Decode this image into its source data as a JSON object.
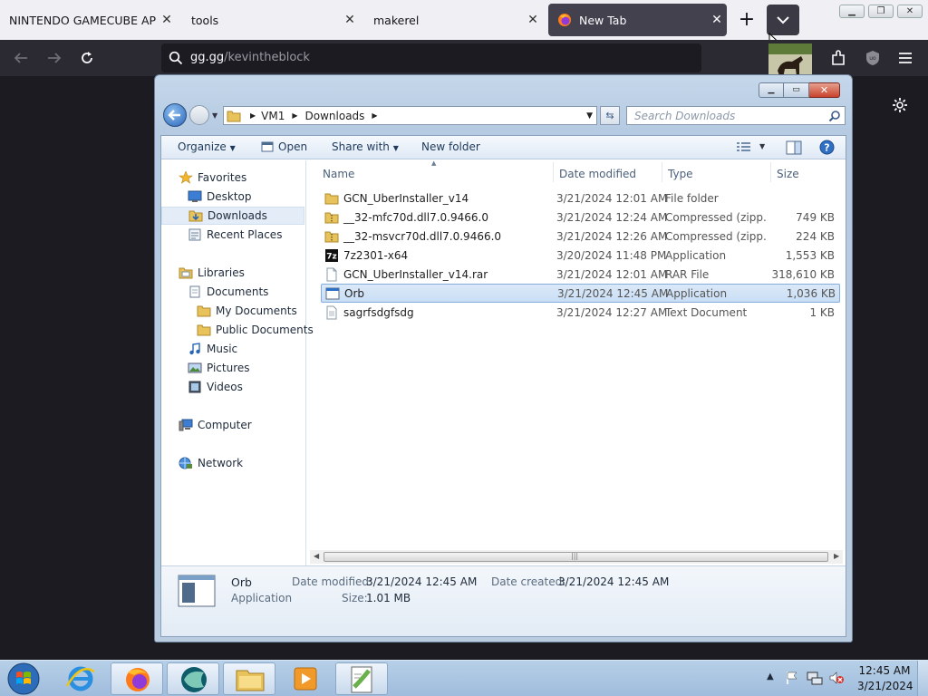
{
  "browser": {
    "tabs": [
      {
        "label": "NINTENDO GAMECUBE API Ref"
      },
      {
        "label": "tools"
      },
      {
        "label": "makerel"
      },
      {
        "label": "New Tab",
        "active": true
      }
    ],
    "close_glyph": "✕",
    "new_tab_glyph": "+",
    "url_host": "gg.gg",
    "url_path": "/kevintheblock",
    "url_placeholder_icon": "search-icon",
    "nav_icons": [
      "back-icon",
      "forward-icon",
      "reload-icon"
    ],
    "toolbar_icons": [
      "extensions-icon",
      "ublock-icon",
      "menu-icon"
    ],
    "colors": {
      "tabstrip": "#f0f0f4",
      "toolbar": "#2b2a33",
      "urlbar": "#1c1b22"
    }
  },
  "explorer": {
    "address": {
      "segments": [
        "VM1",
        "Downloads"
      ]
    },
    "search_placeholder": "Search Downloads",
    "commands": {
      "organize": "Organize",
      "open": "Open",
      "share_with": "Share with",
      "new_folder": "New folder"
    },
    "nav": {
      "favorites": "Favorites",
      "desktop": "Desktop",
      "downloads": "Downloads",
      "recent_places": "Recent Places",
      "libraries": "Libraries",
      "documents": "Documents",
      "my_documents": "My Documents",
      "public_documents": "Public Documents",
      "music": "Music",
      "pictures": "Pictures",
      "videos": "Videos",
      "computer": "Computer",
      "network": "Network"
    },
    "columns": {
      "name": "Name",
      "date": "Date modified",
      "type": "Type",
      "size": "Size"
    },
    "files": [
      {
        "name": "GCN_UberInstaller_v14",
        "date": "3/21/2024 12:01 AM",
        "type": "File folder",
        "size": "",
        "icon": "folder-icon"
      },
      {
        "name": "__32-mfc70d.dll7.0.9466.0",
        "date": "3/21/2024 12:24 AM",
        "type": "Compressed (zipp...",
        "size": "749 KB",
        "icon": "zip-folder-icon"
      },
      {
        "name": "__32-msvcr70d.dll7.0.9466.0",
        "date": "3/21/2024 12:26 AM",
        "type": "Compressed (zipp...",
        "size": "224 KB",
        "icon": "zip-folder-icon"
      },
      {
        "name": "7z2301-x64",
        "date": "3/20/2024 11:48 PM",
        "type": "Application",
        "size": "1,553 KB",
        "icon": "7zip-icon"
      },
      {
        "name": "GCN_UberInstaller_v14.rar",
        "date": "3/21/2024 12:01 AM",
        "type": "RAR File",
        "size": "318,610 KB",
        "icon": "file-icon"
      },
      {
        "name": "Orb",
        "date": "3/21/2024 12:45 AM",
        "type": "Application",
        "size": "1,036 KB",
        "icon": "application-icon",
        "selected": true
      },
      {
        "name": "sagrfsdgfsdg",
        "date": "3/21/2024 12:27 AM",
        "type": "Text Document",
        "size": "1 KB",
        "icon": "text-file-icon"
      }
    ],
    "details": {
      "name": "Orb",
      "type": "Application",
      "date_modified_label": "Date modified:",
      "date_modified": "3/21/2024 12:45 AM",
      "date_created_label": "Date created:",
      "date_created": "3/21/2024 12:45 AM",
      "size_label": "Size:",
      "size": "1.01 MB"
    }
  },
  "taskbar": {
    "time": "12:45 AM",
    "date": "3/21/2024",
    "buttons": [
      "internet-explorer-icon",
      "firefox-icon",
      "orb-app-icon",
      "file-explorer-icon",
      "media-player-icon",
      "notepad-plus-icon"
    ]
  }
}
